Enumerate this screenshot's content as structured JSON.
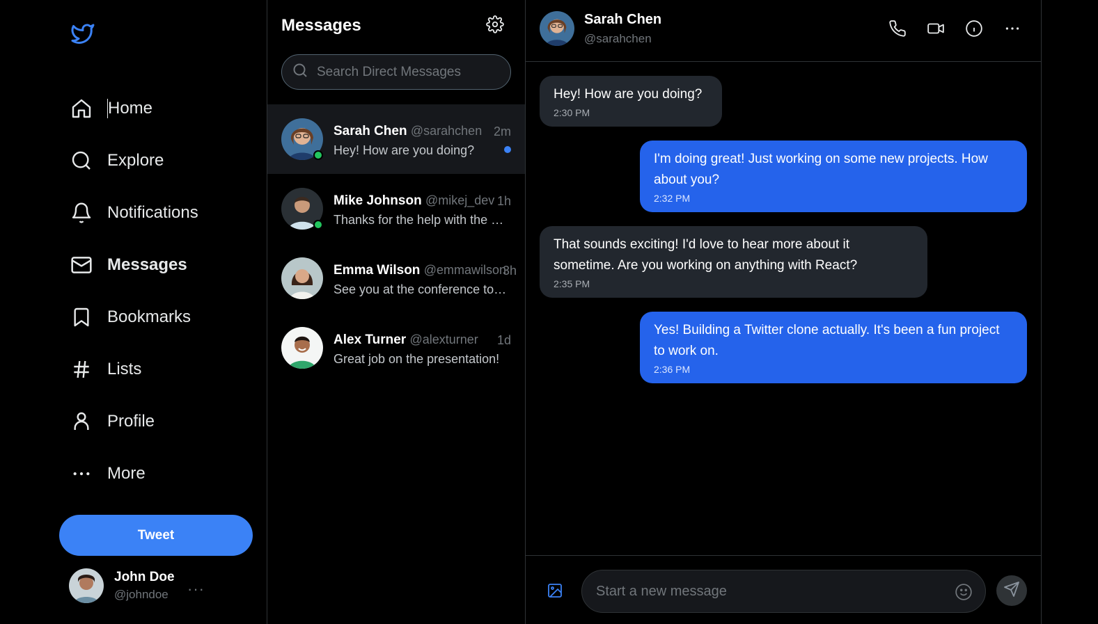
{
  "colors": {
    "accent": "#3b82f6",
    "outgoing_bubble": "#2563eb",
    "incoming_bubble": "#22272e",
    "online": "#22c55e",
    "background": "#000000"
  },
  "nav": {
    "logo_icon": "twitter-bird-icon",
    "items": [
      {
        "label": "Home",
        "icon": "home-icon"
      },
      {
        "label": "Explore",
        "icon": "search-icon"
      },
      {
        "label": "Notifications",
        "icon": "bell-icon"
      },
      {
        "label": "Messages",
        "icon": "mail-icon",
        "active": true
      },
      {
        "label": "Bookmarks",
        "icon": "bookmark-icon"
      },
      {
        "label": "Lists",
        "icon": "hash-icon"
      },
      {
        "label": "Profile",
        "icon": "user-icon"
      },
      {
        "label": "More",
        "icon": "more-horizontal-icon"
      }
    ],
    "tweet_label": "Tweet"
  },
  "current_user": {
    "name": "John Doe",
    "handle": "@johndoe",
    "more": "···"
  },
  "messages_panel": {
    "title": "Messages",
    "search_placeholder": "Search Direct Messages",
    "conversations": [
      {
        "name": "Sarah Chen",
        "handle": "@sarahchen",
        "time": "2m",
        "preview": "Hey! How are you doing?",
        "online": true,
        "unread": true,
        "selected": true
      },
      {
        "name": "Mike Johnson",
        "handle": "@mikej_dev",
        "time": "1h",
        "preview": "Thanks for the help with the React project!",
        "online": true,
        "unread": false
      },
      {
        "name": "Emma Wilson",
        "handle": "@emmawilson",
        "time": "3h",
        "preview": "See you at the conference tomorrow!",
        "online": false,
        "unread": false
      },
      {
        "name": "Alex Turner",
        "handle": "@alexturner",
        "time": "1d",
        "preview": "Great job on the presentation!",
        "online": false,
        "unread": false
      }
    ]
  },
  "chat": {
    "name": "Sarah Chen",
    "handle": "@sarahchen",
    "messages": [
      {
        "direction": "in",
        "text": "Hey! How are you doing?",
        "time": "2:30 PM"
      },
      {
        "direction": "out",
        "text": "I'm doing great! Just working on some new projects. How about you?",
        "time": "2:32 PM"
      },
      {
        "direction": "in",
        "text": "That sounds exciting! I'd love to hear more about it sometime. Are you working on anything with React?",
        "time": "2:35 PM"
      },
      {
        "direction": "out",
        "text": "Yes! Building a Twitter clone actually. It's been a fun project to work on.",
        "time": "2:36 PM"
      }
    ],
    "composer_placeholder": "Start a new message"
  }
}
